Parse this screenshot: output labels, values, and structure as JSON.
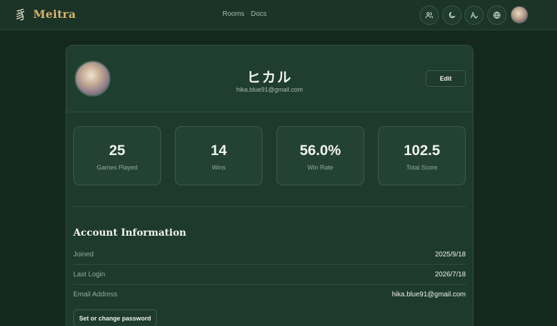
{
  "header": {
    "logo_glyph": "豸",
    "brand": "Meitra",
    "nav": {
      "rooms": "Rooms",
      "docs": "Docs"
    },
    "icons": [
      "users-icon",
      "moon-icon",
      "text-size-icon",
      "globe-icon"
    ]
  },
  "profile": {
    "name": "ヒカル",
    "email": "hika.blue91@gmail.com",
    "edit_label": "Edit"
  },
  "stats": [
    {
      "value": "25",
      "label": "Games Played"
    },
    {
      "value": "14",
      "label": "Wins"
    },
    {
      "value": "56.0%",
      "label": "Win Rate"
    },
    {
      "value": "102.5",
      "label": "Total Score"
    }
  ],
  "account": {
    "title": "Account Information",
    "rows": [
      {
        "label": "Joined",
        "value": "2025/9/18"
      },
      {
        "label": "Last Login",
        "value": "2026/7/18"
      },
      {
        "label": "Email Address",
        "value": "hika.blue91@gmail.com"
      }
    ],
    "password_button": "Set or change password"
  },
  "colors": {
    "background": "#15281f",
    "card": "#1e3a2d",
    "brand_gold": "#d6b46a"
  }
}
